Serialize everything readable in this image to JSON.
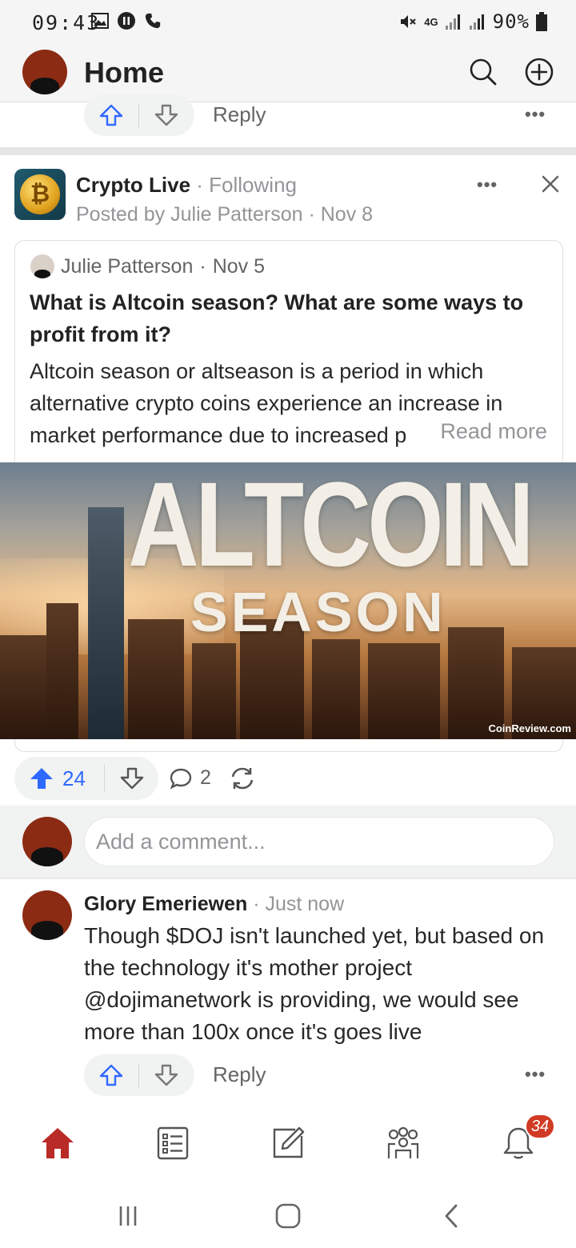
{
  "status_bar": {
    "time": "09:43",
    "network": "4G",
    "battery": "90%"
  },
  "header": {
    "title": "Home"
  },
  "prev_answer": {
    "reply_label": "Reply"
  },
  "post": {
    "space_name": "Crypto Live",
    "follow_label": "Following",
    "posted_by": "Posted by Julie Patterson",
    "posted_date": "Nov 8",
    "quote": {
      "author": "Julie Patterson",
      "date": "Nov 5",
      "title": "What is Altcoin season? What are some ways to profit from it?",
      "body": "Altcoin season or altseason is a period in which alternative crypto coins experience an increase in market performance due to increased p",
      "read_more": "Read more"
    },
    "image": {
      "title": "ALTCOIN",
      "subtitle": "SEASON",
      "credit": "CoinReview.com"
    },
    "upvotes": "24",
    "comments": "2"
  },
  "comment_box": {
    "placeholder": "Add a comment..."
  },
  "comment": {
    "author": "Glory Emeriewen",
    "time": "Just now",
    "text": "Though $DOJ isn't launched yet, but based on the technology it's mother project @dojimanetwork is providing, we would see more than 100x once it's goes live",
    "reply_label": "Reply"
  },
  "bottom_nav": {
    "notifications_badge": "34"
  },
  "colors": {
    "brand_red": "#b92b27",
    "upvote_blue": "#2e69ff",
    "badge_red": "#d13a24"
  },
  "icons": [
    "search-icon",
    "plus-circle-icon",
    "upvote-icon",
    "downvote-icon",
    "comment-icon",
    "share-icon",
    "home-icon",
    "list-icon",
    "edit-icon",
    "spaces-icon",
    "bell-icon",
    "close-icon",
    "more-icon"
  ]
}
